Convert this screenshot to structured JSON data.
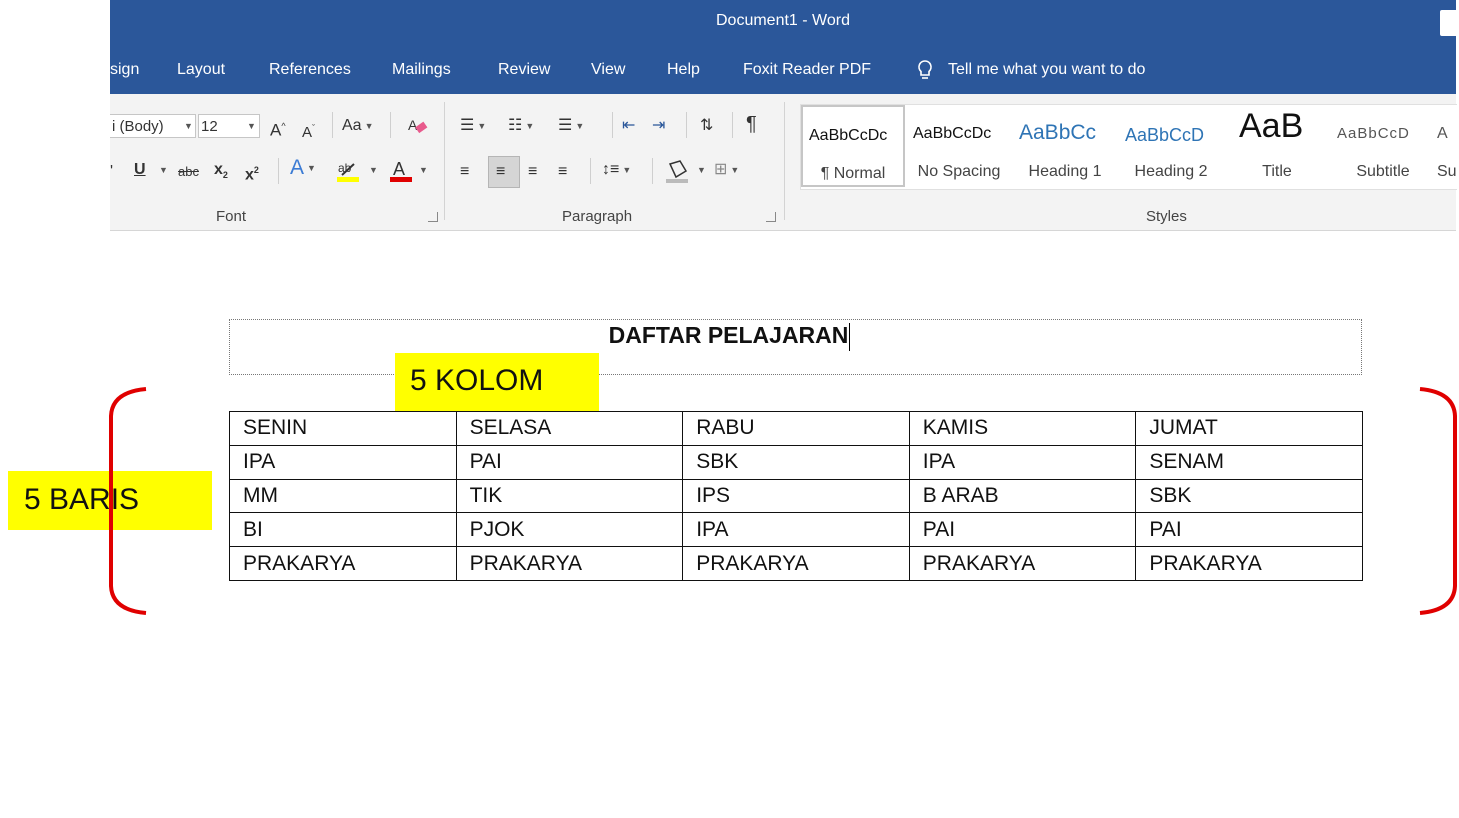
{
  "window": {
    "title": "Document1  -  Word"
  },
  "tabs": [
    "sign",
    "Layout",
    "References",
    "Mailings",
    "Review",
    "View",
    "Help",
    "Foxit Reader PDF"
  ],
  "tell_me": "Tell me what you want to do",
  "font_group": {
    "font_name": "i (Body)",
    "font_size": "12",
    "label": "Font"
  },
  "paragraph_group": {
    "label": "Paragraph"
  },
  "styles_group": {
    "label": "Styles",
    "items": [
      {
        "preview": "AaBbCcDc",
        "name": "¶ Normal"
      },
      {
        "preview": "AaBbCcDc",
        "name": "No Spacing"
      },
      {
        "preview": "AaBbCc",
        "name": "Heading 1"
      },
      {
        "preview": "AaBbCcD",
        "name": "Heading 2"
      },
      {
        "preview": "AaB",
        "name": "Title"
      },
      {
        "preview": "AaBbCcD",
        "name": "Subtitle"
      },
      {
        "preview": "A",
        "name": "Su"
      }
    ]
  },
  "document": {
    "heading": "DAFTAR PELAJARAN",
    "columns_label": "5 KOLOM",
    "rows_label": "5 BARIS",
    "table": [
      [
        "SENIN",
        "SELASA",
        "RABU",
        "KAMIS",
        "JUMAT"
      ],
      [
        "IPA",
        "PAI",
        "SBK",
        "IPA",
        "SENAM"
      ],
      [
        "MM",
        "TIK",
        "IPS",
        "B ARAB",
        "SBK"
      ],
      [
        "BI",
        "PJOK",
        "IPA",
        "PAI",
        "PAI"
      ],
      [
        "PRAKARYA",
        "PRAKARYA",
        "PRAKARYA",
        "PRAKARYA",
        "PRAKARYA"
      ]
    ]
  },
  "colors": {
    "ribbon_blue": "#2b579a",
    "highlight_yellow": "#ffff00",
    "brace_red": "#e00000",
    "font_color_red": "#e00000"
  }
}
